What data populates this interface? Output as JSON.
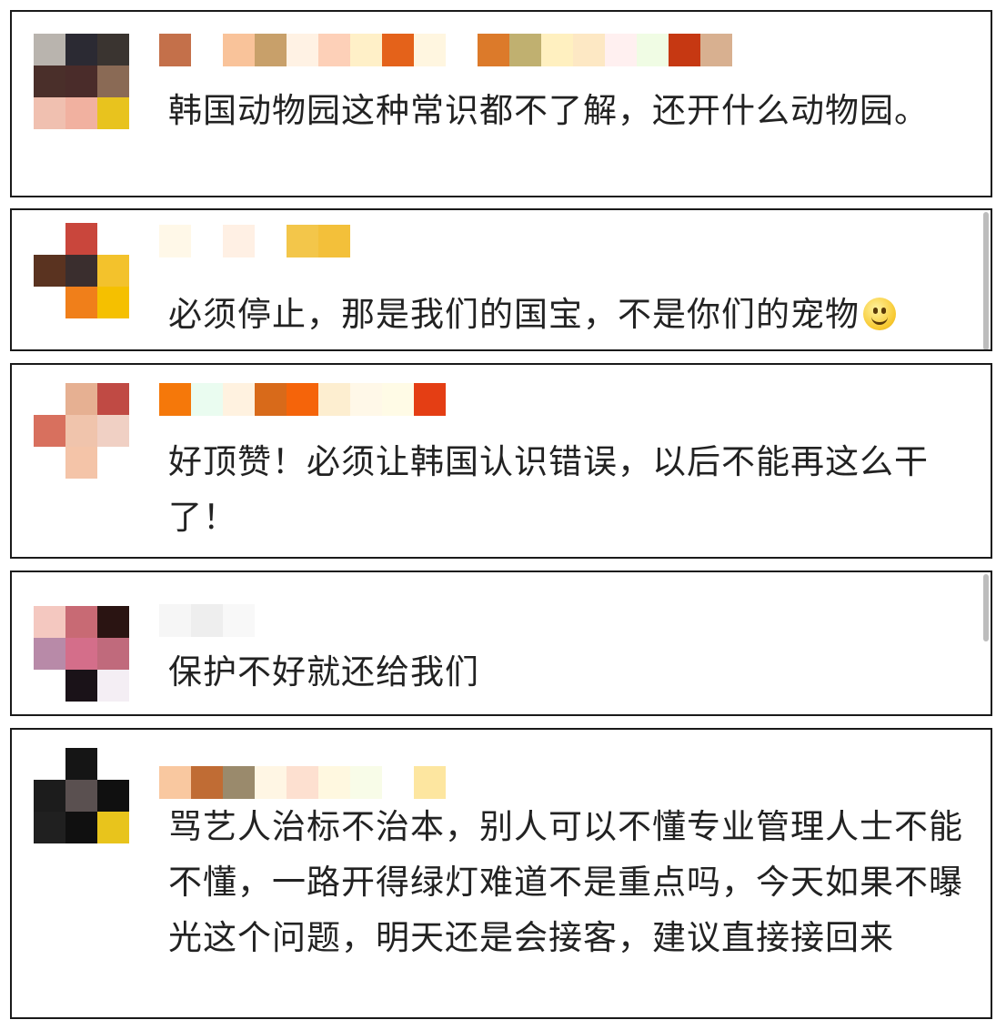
{
  "comments": [
    {
      "text": "韩国动物园这种常识都不了解，还开什么动物园。",
      "avatar_colors": [
        "#b9b4ae",
        "#2b2a33",
        "#3a3430",
        "#4a2f2a",
        "#4a2c2a",
        "#8a6a55",
        "#f0c0b0",
        "#f1b1a0",
        "#e8c31e"
      ],
      "name_colors": [
        "#c4704a",
        "#ffffff",
        "#f9c39a",
        "#c8a06a",
        "#fff2e4",
        "#fdd0b8",
        "#fff0c8",
        "#e4621a",
        "#fff6e0",
        "#ffffff",
        "#dc7a2a",
        "#c0b070",
        "#fff0c0",
        "#fde8c4",
        "#fff0f0",
        "#f0fce4",
        "#c63812",
        "#d8b090"
      ]
    },
    {
      "text": "必须停止，那是我们的国宝，不是你们的宠物",
      "has_emoji": true,
      "avatar_colors": [
        "#ffffff",
        "#c9463c",
        "#ffffff",
        "#5a3320",
        "#3a2e2e",
        "#f3c22c",
        "#ffffff",
        "#f07f1a",
        "#f5c000"
      ],
      "name_colors": [
        "#fff8e8",
        "#ffffff",
        "#fff0e4",
        "#ffffff",
        "#f3c64a",
        "#f3c03a"
      ]
    },
    {
      "text": "好顶赞！必须让韩国认识错误，以后不能再这么干了！",
      "avatar_colors": [
        "#ffffff",
        "#e6b092",
        "#c04a44",
        "#d8705e",
        "#f0c4ac",
        "#f0d0c4",
        "#ffffff",
        "#f4c4a8",
        "#ffffff"
      ],
      "name_colors": [
        "#f5780a",
        "#eafcf0",
        "#fff2e0",
        "#d86a1a",
        "#f5640a",
        "#fdeed0",
        "#fff8e8",
        "#fffbe6",
        "#e43e14"
      ]
    },
    {
      "text": "保护不好就还给我们",
      "avatar_colors": [
        "#f4c8c0",
        "#c86a74",
        "#2a1412",
        "#b88aa8",
        "#d46e8a",
        "#c06a7c",
        "#ffffff",
        "#1a1218",
        "#f4eef4"
      ],
      "name_colors": [
        "#f6f6f6",
        "#eeeeee",
        "#f8f8f8"
      ]
    },
    {
      "text": "骂艺人治标不治本，别人可以不懂专业管理人士不能不懂，一路开得绿灯难道不是重点吗，今天如果不曝光这个问题，明天还是会接客，建议直接接回来",
      "avatar_colors": [
        "#ffffff",
        "#151515",
        "#ffffff",
        "#1c1c1c",
        "#5a5050",
        "#101010",
        "#202020",
        "#101010",
        "#e8c41c"
      ],
      "name_colors": [
        "#f9c8a0",
        "#c06c34",
        "#9a8a6c",
        "#fff6e4",
        "#fde0d0",
        "#fff8e0",
        "#f8fce8",
        "#ffffff",
        "#fde6a0"
      ]
    }
  ]
}
